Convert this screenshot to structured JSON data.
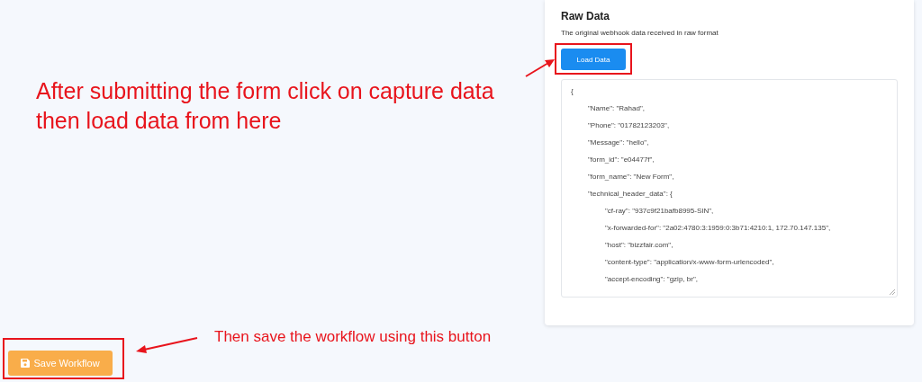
{
  "panel": {
    "title": "Raw Data",
    "description": "The original webhook data received in raw format",
    "load_button": "Load Data",
    "raw_data": [
      {
        "text": "{",
        "children": [
          {
            "text": "\"Name\": \"Rahad\","
          },
          {
            "text": "\"Phone\": \"01782123203\","
          },
          {
            "text": "\"Message\": \"hello\","
          },
          {
            "text": "\"form_id\": \"e04477f\","
          },
          {
            "text": "\"form_name\": \"New Form\","
          },
          {
            "text": "\"technical_header_data\": {",
            "children": [
              {
                "text": "\"cf-ray\": \"937c9f21bafb8995-SIN\","
              },
              {
                "text": "\"x-forwarded-for\": \"2a02:4780:3:1959:0:3b71:4210:1, 172.70.147.135\","
              },
              {
                "text": "\"host\": \"bizzfair.com\","
              },
              {
                "text": "\"content-type\": \"application/x-www-form-urlencoded\","
              },
              {
                "text": "\"accept-encoding\": \"gzip, br\","
              }
            ]
          }
        ]
      }
    ]
  },
  "save_button": "Save Workflow",
  "annotations": [
    "After submitting the form click on capture data then load data from here",
    "Then save the workflow using this button"
  ]
}
